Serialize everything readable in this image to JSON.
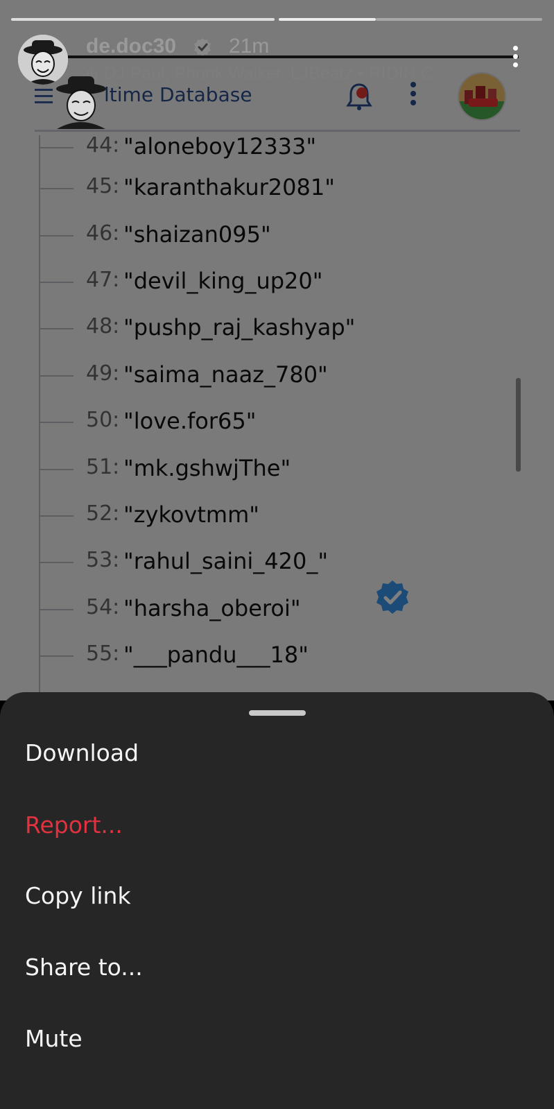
{
  "story": {
    "username": "de.doc30",
    "time_ago": "21m",
    "music": "DJ Paul, Phonk Walker, LJBeatz • RIDIN C..."
  },
  "screenshot": {
    "app_title": "ltime Database",
    "rows": [
      {
        "index": "44:",
        "value": "\"aloneboy12333\""
      },
      {
        "index": "45:",
        "value": "\"karanthakur2081\""
      },
      {
        "index": "46:",
        "value": "\"shaizan095\""
      },
      {
        "index": "47:",
        "value": "\"devil_king_up20\""
      },
      {
        "index": "48:",
        "value": "\"pushp_raj_kashyap\""
      },
      {
        "index": "49:",
        "value": "\"saima_naaz_780\""
      },
      {
        "index": "50:",
        "value": "\"love.for65\""
      },
      {
        "index": "51:",
        "value": "\"mk.gshwjThe\""
      },
      {
        "index": "52:",
        "value": "\"zykovtmm\""
      },
      {
        "index": "53:",
        "value": "\"rahul_saini_420_\""
      },
      {
        "index": "54:",
        "value": "\"harsha_oberoi\""
      },
      {
        "index": "55:",
        "value": "\"___pandu___18\""
      }
    ]
  },
  "menu": {
    "download": "Download",
    "report": "Report...",
    "copy_link": "Copy link",
    "share_to": "Share to...",
    "mute": "Mute"
  },
  "colors": {
    "sheet_bg": "#262626",
    "report_red": "#e2323f",
    "verified_blue": "#3897f0"
  }
}
